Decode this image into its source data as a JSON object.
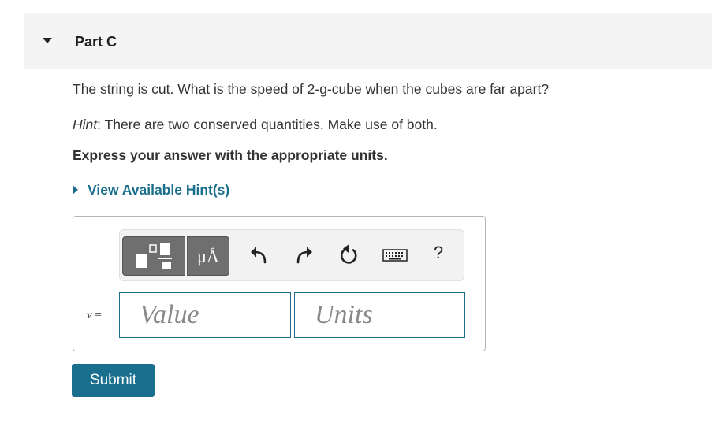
{
  "part": {
    "title": "Part C"
  },
  "question": {
    "text": "The string is cut. What is the speed of 2-g-cube when the cubes are far apart?"
  },
  "hint": {
    "label": "Hint",
    "text": ": There are two conserved quantities. Make use of both."
  },
  "express": {
    "text": "Express your answer with the appropriate units."
  },
  "view_hints": {
    "label": "View Available Hint(s)"
  },
  "toolbar": {
    "units_label": "μÅ",
    "icons": [
      "templates-icon",
      "units-icon",
      "undo-icon",
      "redo-icon",
      "reset-icon",
      "keyboard-icon",
      "help-icon"
    ],
    "help_label": "?"
  },
  "answer": {
    "variable": "v",
    "equals": " =",
    "value_placeholder": "Value",
    "units_placeholder": "Units"
  },
  "submit": {
    "label": "Submit"
  },
  "colors": {
    "accent": "#1a6e8c",
    "button": "#1b6f8e",
    "header_bg": "#f4f4f4"
  }
}
